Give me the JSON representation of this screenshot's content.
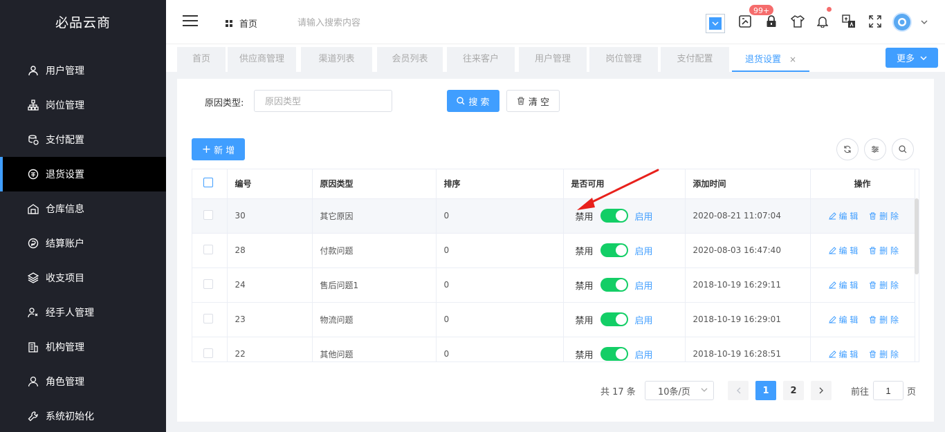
{
  "sidebar": {
    "brand": "必品云商",
    "items": [
      {
        "label": "用户管理",
        "icon": "user-icon"
      },
      {
        "label": "岗位管理",
        "icon": "org-chart-icon"
      },
      {
        "label": "支付配置",
        "icon": "coins-icon"
      },
      {
        "label": "退货设置",
        "icon": "return-goods-icon",
        "active": true
      },
      {
        "label": "仓库信息",
        "icon": "warehouse-icon"
      },
      {
        "label": "结算账户",
        "icon": "settlement-icon"
      },
      {
        "label": "收支项目",
        "icon": "layers-icon"
      },
      {
        "label": "经手人管理",
        "icon": "handler-icon"
      },
      {
        "label": "机构管理",
        "icon": "building-icon"
      },
      {
        "label": "角色管理",
        "icon": "role-icon"
      },
      {
        "label": "系统初始化",
        "icon": "wrench-icon"
      }
    ]
  },
  "header": {
    "home": "首页",
    "search_placeholder": "请输入搜索内容",
    "badge": "99+"
  },
  "tabs": {
    "items": [
      "首页",
      "供应商管理",
      "渠道列表",
      "会员列表",
      "往来客户",
      "用户管理",
      "岗位管理",
      "支付配置",
      "退货设置"
    ],
    "active_index": 8,
    "close": "×",
    "more": "更多"
  },
  "filter": {
    "label": "原因类型:",
    "placeholder": "原因类型",
    "search_button": "搜 索",
    "clear_button": "清 空",
    "add_button": "新 增"
  },
  "table": {
    "headers": [
      "编号",
      "原因类型",
      "排序",
      "是否可用",
      "添加时间",
      "操作"
    ],
    "off_label": "禁用",
    "on_label": "启用",
    "edit_label": "编 辑",
    "delete_label": "删 除",
    "rows": [
      {
        "id": "30",
        "reason": "其它原因",
        "sort": "0",
        "enabled": true,
        "time": "2020-08-21 11:07:04"
      },
      {
        "id": "28",
        "reason": "付款问题",
        "sort": "0",
        "enabled": true,
        "time": "2020-08-03 16:47:40"
      },
      {
        "id": "24",
        "reason": "售后问题1",
        "sort": "0",
        "enabled": true,
        "time": "2018-10-19 16:29:11"
      },
      {
        "id": "23",
        "reason": "物流问题",
        "sort": "0",
        "enabled": true,
        "time": "2018-10-19 16:29:01"
      },
      {
        "id": "22",
        "reason": "其他问题",
        "sort": "0",
        "enabled": true,
        "time": "2018-10-19 16:28:51"
      }
    ]
  },
  "pagination": {
    "total": "共 17 条",
    "page_size": "10条/页",
    "pages": [
      "1",
      "2"
    ],
    "current": "1",
    "goto_label": "前往",
    "goto_value": "1",
    "page_suffix": "页"
  },
  "colors": {
    "sidebar_bg": "#20222a",
    "accent": "#409eff",
    "switch_on": "#13ce66",
    "badge": "#f56c6c",
    "annotation": "#e8211c"
  }
}
